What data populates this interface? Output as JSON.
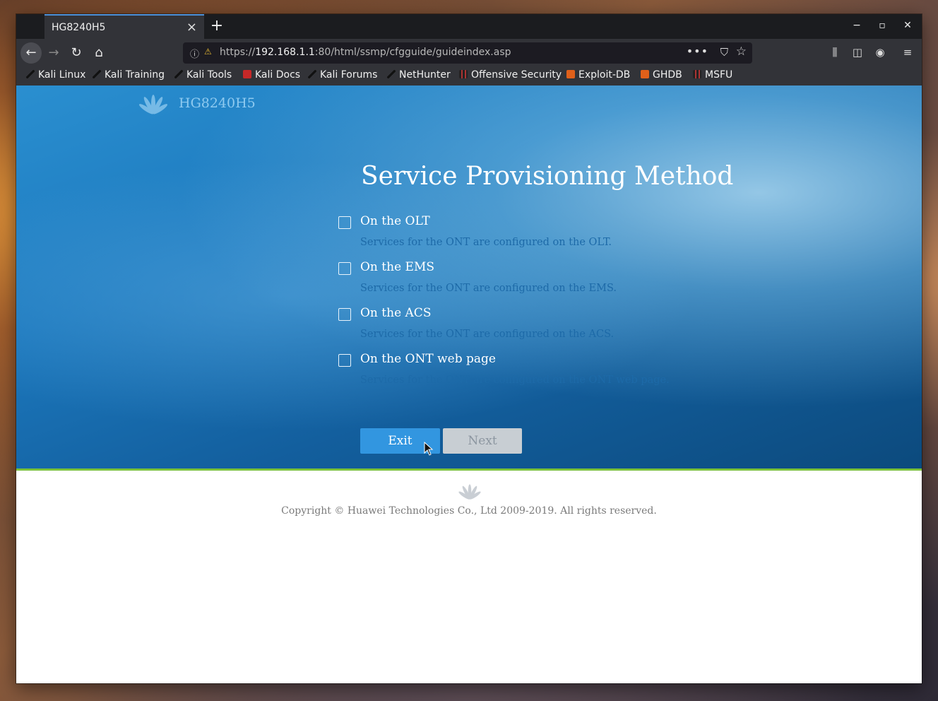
{
  "browser": {
    "tab_title": "HG8240H5",
    "tab_close_glyph": "×",
    "new_tab_glyph": "+",
    "window_controls": {
      "minimize": "−",
      "maximize": "▫",
      "close": "✕"
    },
    "nav": {
      "back": "←",
      "forward": "→",
      "reload": "↻",
      "home": "⌂"
    },
    "url": {
      "scheme": "https://",
      "host": "192.168.1.1",
      "rest": ":80/html/ssmp/cfgguide/guideindex.asp"
    },
    "url_icons": {
      "info": "ⓘ",
      "lock": "⚠",
      "more": "•••",
      "pocket": "⛉",
      "star": "☆"
    },
    "toolbar_icons": {
      "library": "⫼",
      "sidebar": "◫",
      "account": "◉",
      "menu": "≡"
    },
    "bookmarks": [
      {
        "label": "Kali Linux",
        "icon": "kali-dragon-icon"
      },
      {
        "label": "Kali Training",
        "icon": "kali-dragon-icon"
      },
      {
        "label": "Kali Tools",
        "icon": "kali-dragon-icon"
      },
      {
        "label": "Kali Docs",
        "icon": "kali-docs-icon"
      },
      {
        "label": "Kali Forums",
        "icon": "kali-dragon-icon"
      },
      {
        "label": "NetHunter",
        "icon": "kali-dragon-icon"
      },
      {
        "label": "Offensive Security",
        "icon": "offsec-icon"
      },
      {
        "label": "Exploit-DB",
        "icon": "flame-icon"
      },
      {
        "label": "GHDB",
        "icon": "flame-icon"
      },
      {
        "label": "MSFU",
        "icon": "offsec-icon"
      }
    ]
  },
  "page": {
    "brand_name": "HG8240H5",
    "heading": "Service Provisioning Method",
    "options": [
      {
        "label": "On the OLT",
        "description": "Services for the ONT are configured on the OLT.",
        "checked": false
      },
      {
        "label": "On the EMS",
        "description": "Services for the ONT are configured on the EMS.",
        "checked": false
      },
      {
        "label": "On the ACS",
        "description": "Services for the ONT are configured on the ACS.",
        "checked": false
      },
      {
        "label": "On the ONT web page",
        "description": "Services for the ONT are configured on the ONT web page.",
        "checked": false
      }
    ],
    "buttons": {
      "exit": "Exit",
      "next": "Next"
    },
    "copyright": "Copyright © Huawei Technologies Co., Ltd 2009-2019. All rights reserved."
  },
  "colors": {
    "hero_blue": "#1c78bd",
    "accent_green": "#7cc23a",
    "exit_button": "#3296e0",
    "next_button_disabled": "#c8ced3",
    "description_text": "#1d6aa8"
  }
}
